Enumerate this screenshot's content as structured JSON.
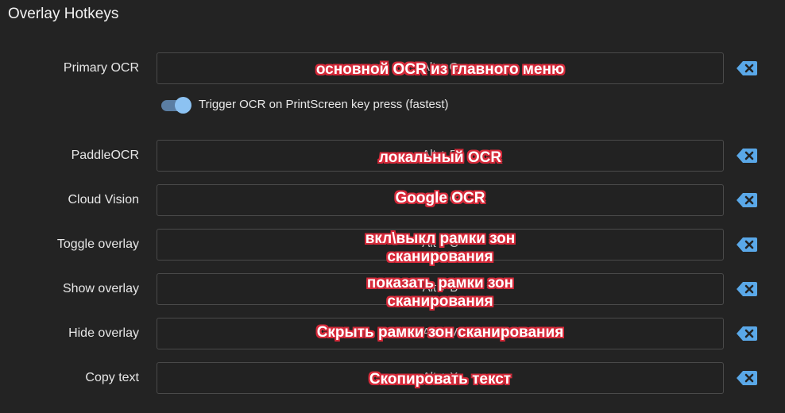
{
  "window": {
    "title": "Overlay Hotkeys"
  },
  "colors": {
    "background": "#232323",
    "field_border": "#4a4a4a",
    "toggle_accent": "#8cc2f2",
    "clear_icon": "#5aa8e8",
    "annotation_outline": "#d62a3a"
  },
  "toggle": {
    "label": "Trigger OCR on PrintScreen key press (fastest)",
    "checked": true
  },
  "hotkeys": [
    {
      "label": "Primary OCR",
      "value": "Alt + Q",
      "annotation": [
        "основной OCR из главного меню"
      ],
      "clear_icon": "backspace-x-icon"
    },
    {
      "label": "PaddleOCR",
      "value": "Alt + R",
      "annotation": [
        "локальный OCR"
      ],
      "clear_icon": "backspace-x-icon"
    },
    {
      "label": "Cloud Vision",
      "value": "Alt + G",
      "annotation": [
        "Google OCR"
      ],
      "clear_icon": "backspace-x-icon"
    },
    {
      "label": "Toggle overlay",
      "value": "Alt + C",
      "annotation": [
        "вкл\\выкл рамки зон",
        "сканирования"
      ],
      "clear_icon": "backspace-x-icon"
    },
    {
      "label": "Show overlay",
      "value": "Alt + B",
      "annotation": [
        "показать рамки зон",
        "сканирования"
      ],
      "clear_icon": "backspace-x-icon"
    },
    {
      "label": "Hide overlay",
      "value": "Alt + V",
      "annotation": [
        "Скрыть рамки зон сканирования"
      ],
      "clear_icon": "backspace-x-icon"
    },
    {
      "label": "Copy text",
      "value": "Alt + X",
      "annotation": [
        "Скопировать текст"
      ],
      "clear_icon": "backspace-x-icon"
    }
  ]
}
